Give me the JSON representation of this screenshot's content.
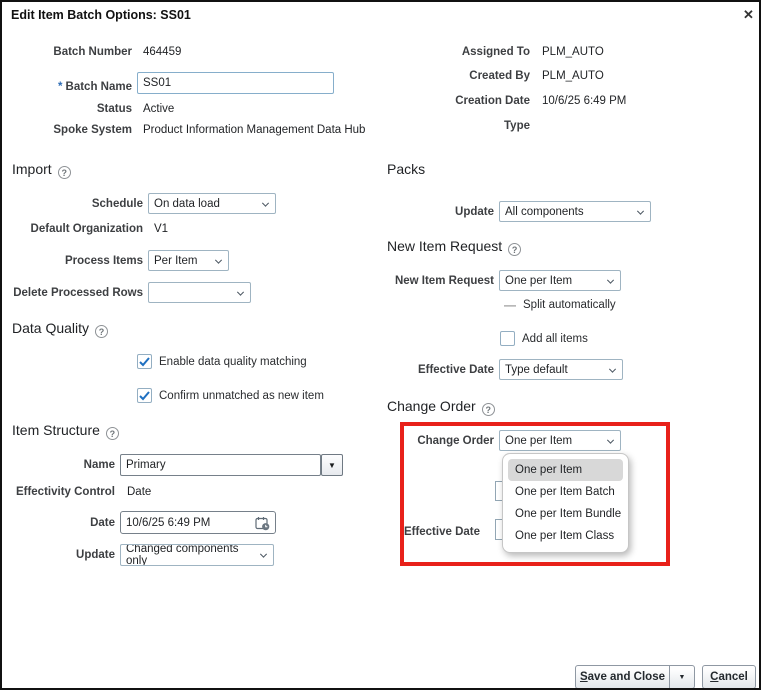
{
  "dialog": {
    "title": "Edit Item Batch Options: SS01",
    "close_icon": "✕"
  },
  "header_left": {
    "batch_number_label": "Batch Number",
    "batch_number_value": "464459",
    "required_marker": "*",
    "batch_name_label": "Batch Name",
    "batch_name_value": "SS01",
    "status_label": "Status",
    "status_value": "Active",
    "spoke_system_label": "Spoke System",
    "spoke_system_value": "Product Information Management Data Hub"
  },
  "header_right": {
    "assigned_to_label": "Assigned To",
    "assigned_to_value": "PLM_AUTO",
    "created_by_label": "Created By",
    "created_by_value": "PLM_AUTO",
    "creation_date_label": "Creation Date",
    "creation_date_value": "10/6/25 6:49 PM",
    "type_label": "Type",
    "type_value": ""
  },
  "import_section": {
    "heading": "Import",
    "schedule_label": "Schedule",
    "schedule_value": "On data load",
    "default_organization_label": "Default Organization",
    "default_organization_value": "V1",
    "process_items_label": "Process Items",
    "process_items_value": "Per Item",
    "delete_processed_rows_label": "Delete Processed Rows",
    "delete_processed_rows_value": ""
  },
  "data_quality_section": {
    "heading": "Data Quality",
    "enable_matching_label": "Enable data quality matching",
    "enable_matching_checked": true,
    "confirm_unmatched_label": "Confirm unmatched as new item",
    "confirm_unmatched_checked": true
  },
  "item_structure_section": {
    "heading": "Item Structure",
    "name_label": "Name",
    "name_value": "Primary",
    "effectivity_control_label": "Effectivity Control",
    "effectivity_control_value": "Date",
    "date_label": "Date",
    "date_value": "10/6/25 6:49 PM",
    "update_label": "Update",
    "update_value": "Changed components only"
  },
  "packs_section": {
    "heading": "Packs",
    "update_label": "Update",
    "update_value": "All components"
  },
  "new_item_request_section": {
    "heading": "New Item Request",
    "request_label": "New Item Request",
    "request_value": "One per Item",
    "split_automatically_label": "Split automatically",
    "add_all_items_label": "Add all items",
    "add_all_items_checked": false,
    "effective_date_label": "Effective Date",
    "effective_date_value": "Type default"
  },
  "change_order_section": {
    "heading": "Change Order",
    "change_order_label": "Change Order",
    "change_order_value": "One per Item",
    "effective_date_label": "Effective Date",
    "dropdown_options": [
      "One per Item",
      "One per Item Batch",
      "One per Item Bundle",
      "One per Item Class"
    ],
    "selected_option": "One per Item"
  },
  "footer": {
    "save_and_close_label": "Save and Close",
    "cancel_label": "Cancel"
  },
  "colors": {
    "highlight_red": "#e8211a",
    "checkbox_check_blue": "#1f70c1",
    "required_asterisk_blue": "#2e6db5"
  }
}
